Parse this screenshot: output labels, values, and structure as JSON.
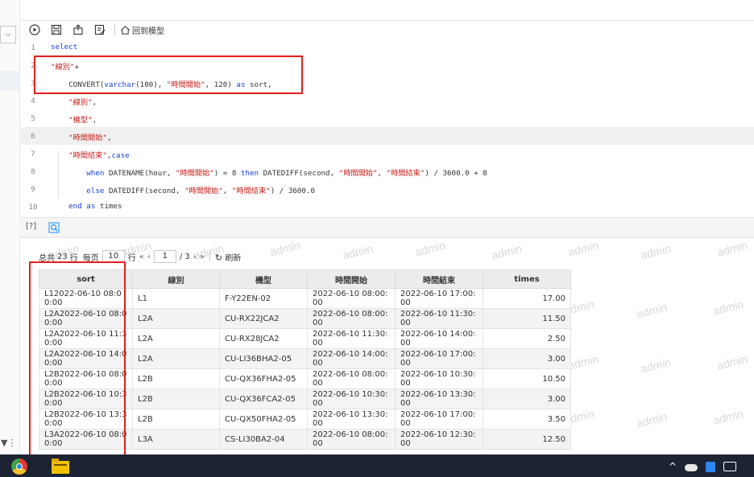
{
  "toolbar": {
    "run_icon": "play-circle-icon",
    "save_icon": "save-icon",
    "export_icon": "export-icon",
    "edit_icon": "edit-icon",
    "back_icon": "home-icon",
    "back_label": "回到模型"
  },
  "editor": {
    "lines": [
      {
        "n": "1",
        "parts": [
          {
            "t": "select",
            "c": "kw"
          }
        ]
      },
      {
        "n": "2",
        "parts": [
          {
            "t": "\"線別\"",
            "c": "str"
          },
          {
            "t": "+",
            "c": ""
          }
        ]
      },
      {
        "n": "3",
        "parts": [
          {
            "t": "    CONVERT(",
            "c": ""
          },
          {
            "t": "varchar",
            "c": "kw"
          },
          {
            "t": "(100), ",
            "c": ""
          },
          {
            "t": "\"時間開始\"",
            "c": "str"
          },
          {
            "t": ", 120) ",
            "c": ""
          },
          {
            "t": "as",
            "c": "kw"
          },
          {
            "t": " sort,",
            "c": ""
          }
        ]
      },
      {
        "n": "4",
        "parts": [
          {
            "t": "    ",
            "c": ""
          },
          {
            "t": "\"線別\"",
            "c": "str"
          },
          {
            "t": ",",
            "c": ""
          }
        ]
      },
      {
        "n": "5",
        "parts": [
          {
            "t": "    ",
            "c": ""
          },
          {
            "t": "\"機型\"",
            "c": "str"
          },
          {
            "t": ",",
            "c": ""
          }
        ]
      },
      {
        "n": "6",
        "parts": [
          {
            "t": "    ",
            "c": ""
          },
          {
            "t": "\"時間開始\"",
            "c": "str"
          },
          {
            "t": ",",
            "c": ""
          }
        ]
      },
      {
        "n": "7",
        "parts": [
          {
            "t": "    ",
            "c": ""
          },
          {
            "t": "\"時間結束\"",
            "c": "str"
          },
          {
            "t": ",",
            "c": ""
          },
          {
            "t": "case",
            "c": "kw"
          }
        ]
      },
      {
        "n": "8",
        "parts": [
          {
            "t": "        ",
            "c": ""
          },
          {
            "t": "when",
            "c": "kw"
          },
          {
            "t": " DATENAME(hour, ",
            "c": ""
          },
          {
            "t": "\"時間開始\"",
            "c": "str"
          },
          {
            "t": ") = 8 ",
            "c": ""
          },
          {
            "t": "then",
            "c": "kw"
          },
          {
            "t": " DATEDIFF(second, ",
            "c": ""
          },
          {
            "t": "\"時間開始\"",
            "c": "str"
          },
          {
            "t": ", ",
            "c": ""
          },
          {
            "t": "\"時間結束\"",
            "c": "str"
          },
          {
            "t": ") / 3600.0 + 8",
            "c": ""
          }
        ]
      },
      {
        "n": "9",
        "parts": [
          {
            "t": "        ",
            "c": ""
          },
          {
            "t": "else",
            "c": "kw"
          },
          {
            "t": " DATEDIFF(second, ",
            "c": ""
          },
          {
            "t": "\"時間開始\"",
            "c": "str"
          },
          {
            "t": ", ",
            "c": ""
          },
          {
            "t": "\"時間結束\"",
            "c": "str"
          },
          {
            "t": ") / 3600.0",
            "c": ""
          }
        ]
      },
      {
        "n": "10",
        "parts": [
          {
            "t": "    ",
            "c": ""
          },
          {
            "t": "end",
            "c": "kw"
          },
          {
            "t": " ",
            "c": ""
          },
          {
            "t": "as",
            "c": "kw"
          },
          {
            "t": " times",
            "c": ""
          }
        ]
      }
    ],
    "active_line": "6"
  },
  "panel": {
    "help_tab": "[?]",
    "search_icon": "search-icon"
  },
  "pager": {
    "total_prefix": "总共",
    "total": "23",
    "total_suffix": "行",
    "per_page_label": "每页",
    "per_page": "10",
    "per_page_suffix": "行",
    "first": "«",
    "prev": "‹",
    "page": "1",
    "pages": "/ 3",
    "next": "›",
    "last": "»",
    "refresh": "刷新"
  },
  "table": {
    "headers": [
      "sort",
      "線別",
      "機型",
      "時間開始",
      "時間結束",
      "times"
    ],
    "rows": [
      [
        "L12022-06-10 08:00:00",
        "L1",
        "F-Y22EN-02",
        "2022-06-10 08:00:00",
        "2022-06-10 17:00:00",
        "17.00"
      ],
      [
        "L2A2022-06-10 08:00:00",
        "L2A",
        "CU-RX22JCA2",
        "2022-06-10 08:00:00",
        "2022-06-10 11:30:00",
        "11.50"
      ],
      [
        "L2A2022-06-10 11:30:00",
        "L2A",
        "CU-RX28JCA2",
        "2022-06-10 11:30:00",
        "2022-06-10 14:00:00",
        "2.50"
      ],
      [
        "L2A2022-06-10 14:00:00",
        "L2A",
        "CU-LI36BHA2-05",
        "2022-06-10 14:00:00",
        "2022-06-10 17:00:00",
        "3.00"
      ],
      [
        "L2B2022-06-10 08:00:00",
        "L2B",
        "CU-QX36FHA2-05",
        "2022-06-10 08:00:00",
        "2022-06-10 10:30:00",
        "10.50"
      ],
      [
        "L2B2022-06-10 10:30:00",
        "L2B",
        "CU-QX36FCA2-05",
        "2022-06-10 10:30:00",
        "2022-06-10 13:30:00",
        "3.00"
      ],
      [
        "L2B2022-06-10 13:30:00",
        "L2B",
        "CU-QX50FHA2-05",
        "2022-06-10 13:30:00",
        "2022-06-10 17:00:00",
        "3.50"
      ],
      [
        "L3A2022-06-10 08:00:00",
        "L3A",
        "CS-LI30BA2-04",
        "2022-06-10 08:00:00",
        "2022-06-10 12:30:00",
        "12.50"
      ]
    ]
  },
  "watermark": "admin",
  "colors": {
    "highlight": "#e41e1e",
    "keyword": "#1a3fd9",
    "string": "#c41a16",
    "taskbar": "#1c2433"
  },
  "taskbar": {
    "icons": [
      "chrome-icon",
      "folder-icon"
    ],
    "tray_icons": [
      "chevron-up-icon",
      "cloud-icon",
      "app-icon",
      "device-icon"
    ],
    "chevron": "^"
  }
}
